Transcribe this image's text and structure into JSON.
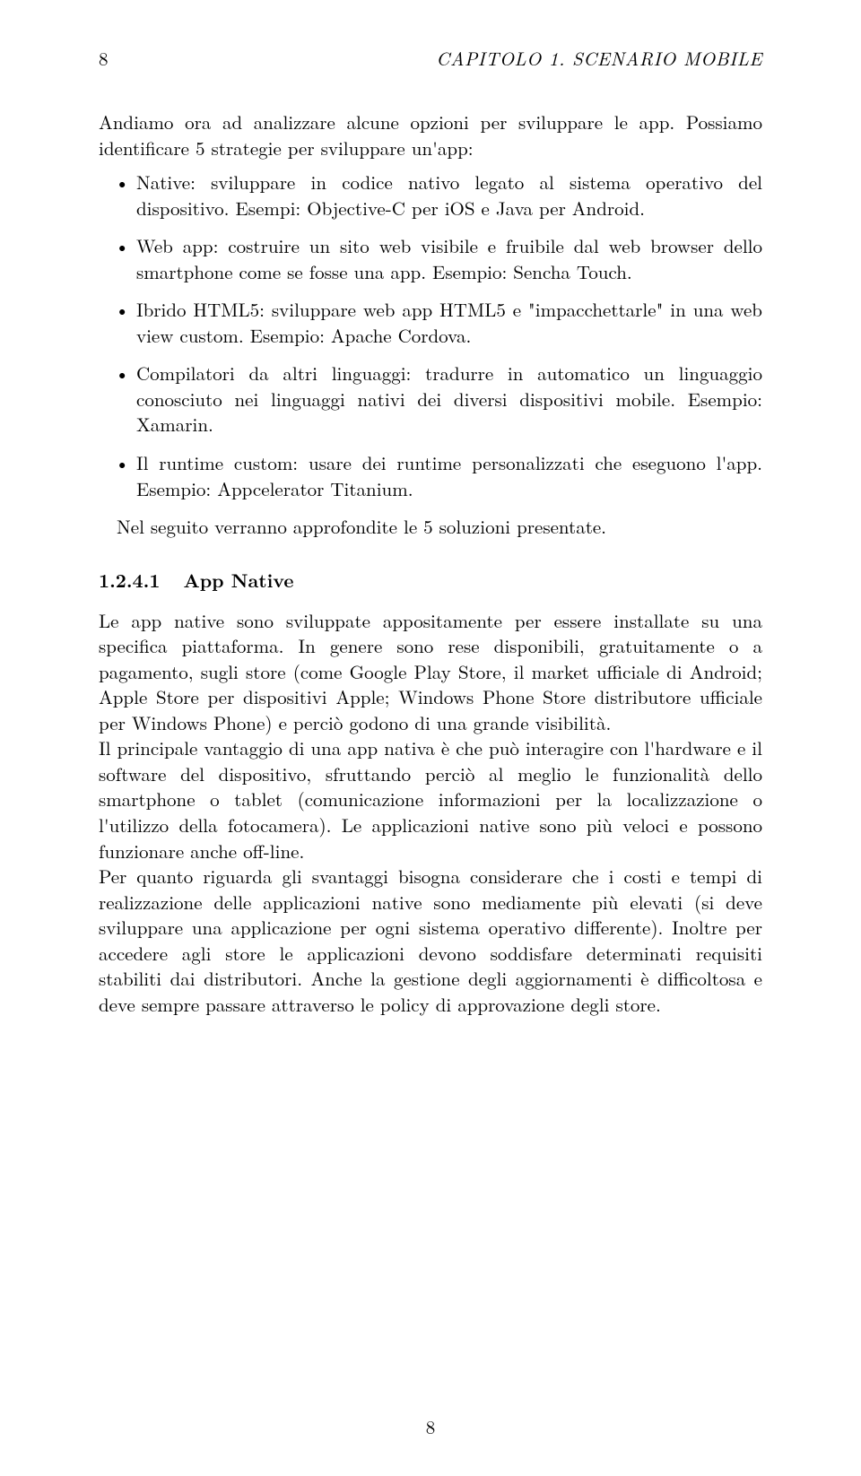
{
  "header": {
    "page_num": "8",
    "chapter": "CAPITOLO 1.",
    "title": "SCENARIO MOBILE"
  },
  "intro": "Andiamo ora ad analizzare alcune opzioni per sviluppare le app. Possiamo identificare 5 strategie per sviluppare un'app:",
  "bullets": [
    "Native: sviluppare in codice nativo legato al sistema operativo del dispositivo. Esempi: Objective-C per iOS e Java per Android.",
    "Web app: costruire un sito web visibile e fruibile dal web browser dello smartphone come se fosse una app. Esempio: Sencha Touch.",
    "Ibrido HTML5: sviluppare web app HTML5 e \"impacchettarle\" in una web view custom. Esempio: Apache Cordova.",
    "Compilatori da altri linguaggi: tradurre in automatico un linguaggio conosciuto nei linguaggi nativi dei diversi dispositivi mobile. Esempio: Xamarin.",
    "Il runtime custom: usare dei runtime personalizzati che eseguono l'app. Esempio: Appcelerator Titanium."
  ],
  "after_bullets": "Nel seguito verranno approfondite le 5 soluzioni presentate.",
  "subsection": {
    "num": "1.2.4.1",
    "title": "App Native"
  },
  "body_p1": "Le app native sono sviluppate appositamente per essere installate su una specifica piattaforma. In genere sono rese disponibili, gratuitamente o a pagamento, sugli store (come Google Play Store, il market ufficiale di Android; Apple Store per dispositivi Apple; Windows Phone Store distributore ufficiale per Windows Phone) e perciò godono di una grande visibilità.",
  "body_p2": "Il principale vantaggio di una app nativa è che può interagire con l'hardware e il software del dispositivo, sfruttando perciò al meglio le funzionalità dello smartphone o tablet (comunicazione informazioni per la localizzazione o l'utilizzo della fotocamera). Le applicazioni native sono più veloci e possono funzionare anche off-line.",
  "body_p3": "Per quanto riguarda gli svantaggi bisogna considerare che i costi e tempi di realizzazione delle applicazioni native sono mediamente più elevati (si deve sviluppare una applicazione per ogni sistema operativo differente). Inoltre per accedere agli store le applicazioni devono soddisfare determinati requisiti stabiliti dai distributori. Anche la gestione degli aggiornamenti è difficoltosa e deve sempre passare attraverso le policy di approvazione degli store.",
  "footer_page": "8"
}
